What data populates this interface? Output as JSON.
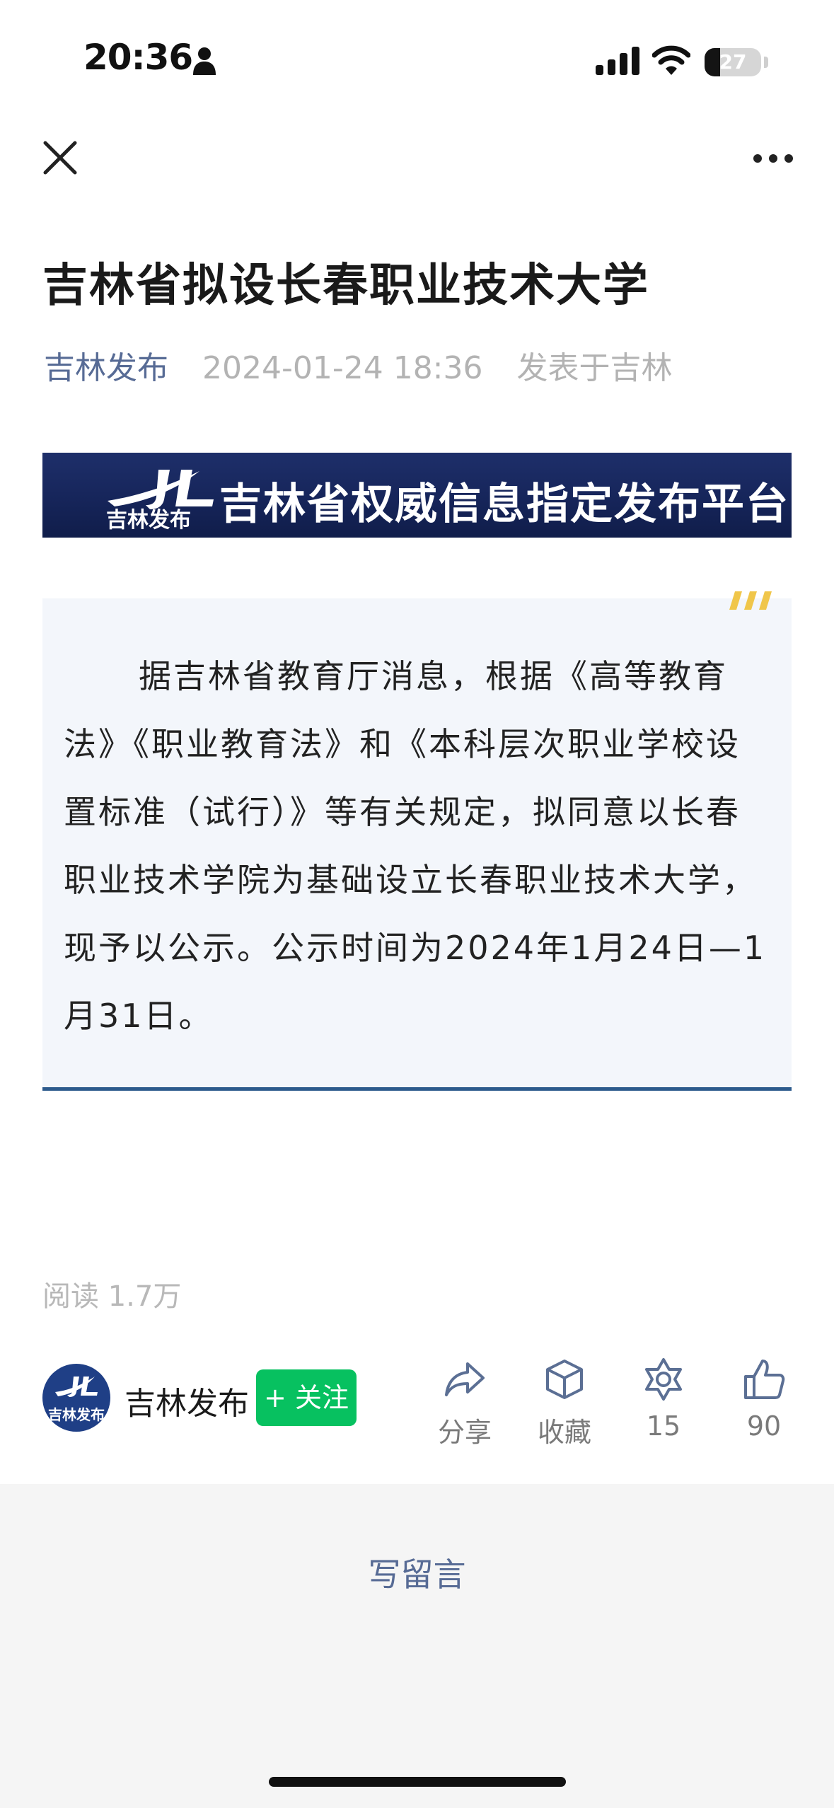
{
  "status_bar": {
    "time": "20:36",
    "battery_level": "27",
    "battery_fraction": 0.27
  },
  "nav": {
    "close_icon": "close-icon",
    "more_icon": "more-icon"
  },
  "article": {
    "title": "吉林省拟设长春职业技术大学",
    "author": "吉林发布",
    "date": "2024-01-24 18:36",
    "location": "发表于吉林"
  },
  "banner": {
    "logo_text": "吉林发布",
    "text": "吉林省权威信息指定发布平台"
  },
  "quote": {
    "text": "据吉林省教育厅消息，根据《高等教育法》《职业教育法》和《本科层次职业学校设置标准（试行）》等有关规定，拟同意以长春职业技术学院为基础设立长春职业技术大学，现予以公示。公示时间为2024年1月24日—1月31日。"
  },
  "stats": {
    "read_count": "阅读 1.7万"
  },
  "author_bar": {
    "avatar_text": "吉林发布",
    "name": "吉林发布",
    "follow_label": "+ 关注",
    "actions": {
      "share": "分享",
      "favorite": "收藏",
      "wow": "15",
      "like": "90"
    }
  },
  "comment": {
    "write_label": "写留言"
  },
  "colors": {
    "link_blue": "#576b95",
    "follow_green": "#07c160",
    "banner_navy": "#16255a",
    "quote_bg": "#f3f6fb",
    "quote_accent": "#f0c64a"
  }
}
